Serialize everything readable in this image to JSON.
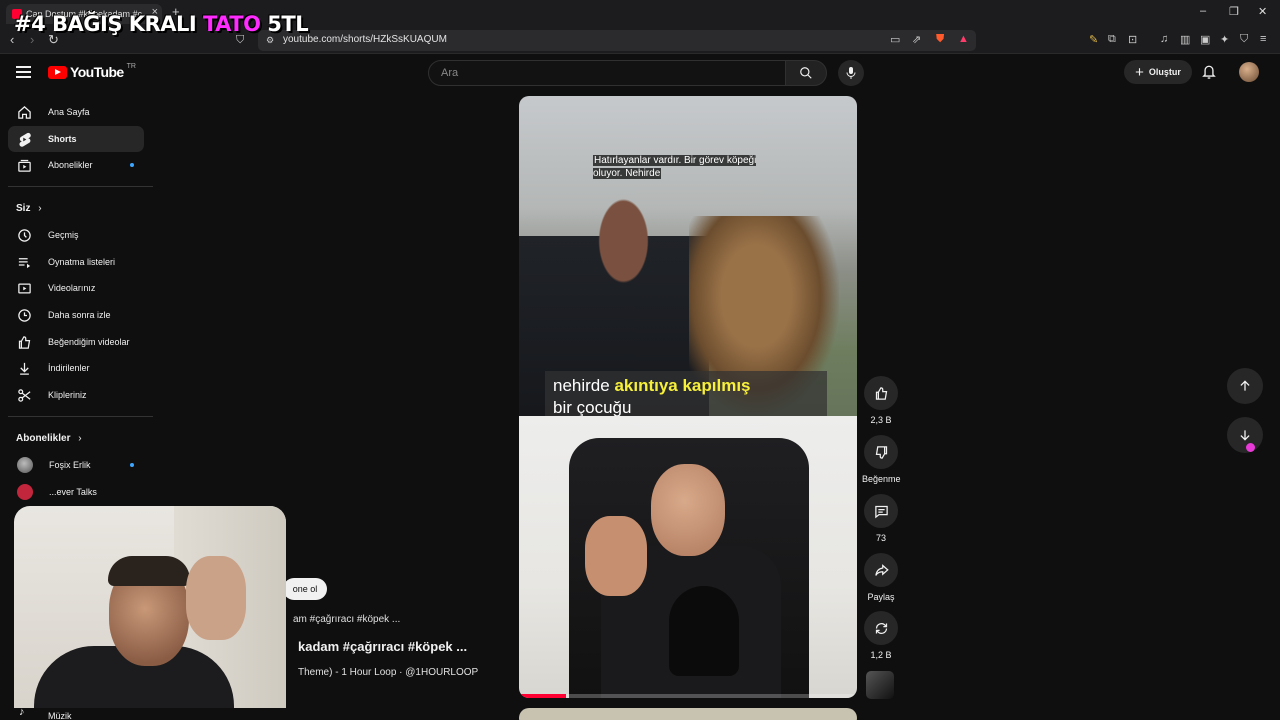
{
  "browser": {
    "tab_title": "Can Dostum #köpekadam #ç",
    "url": "youtube.com/shorts/HZkSsKUAQUM"
  },
  "overlay": {
    "part1": "#4 BAĞIŞ KRALI",
    "part2": "TATO",
    "part3": "5TL"
  },
  "header": {
    "logo_text": "YouTube",
    "logo_region": "TR",
    "search_placeholder": "Ara",
    "create_label": "Oluştur"
  },
  "sidebar": {
    "items": [
      {
        "label": "Ana Sayfa",
        "icon": "home-icon"
      },
      {
        "label": "Shorts",
        "icon": "shorts-icon",
        "active": true
      },
      {
        "label": "Abonelikler",
        "icon": "subscriptions-icon"
      }
    ],
    "you_heading": "Siz",
    "you_items": [
      {
        "label": "Geçmiş",
        "icon": "history-icon"
      },
      {
        "label": "Oynatma listeleri",
        "icon": "playlist-icon"
      },
      {
        "label": "Videolarınız",
        "icon": "video-icon"
      },
      {
        "label": "Daha sonra izle",
        "icon": "clock-icon"
      },
      {
        "label": "Beğendiğim videolar",
        "icon": "like-icon"
      },
      {
        "label": "İndirilenler",
        "icon": "download-icon"
      },
      {
        "label": "Klipleriniz",
        "icon": "scissors-icon"
      }
    ],
    "subs_heading": "Abonelikler",
    "channels": [
      {
        "name": "Foşix Erlik"
      },
      {
        "name": "...ever Talks"
      }
    ],
    "bottom_item": "Müzik"
  },
  "short": {
    "caption_top": "Hatırlayanlar vardır. Bir görev köpeği oluyor. Nehirde",
    "caption_bottom_1": "nehirde ",
    "caption_bottom_hl": "akıntıya kapılmış",
    "caption_bottom_2": "bir çocuğu",
    "progress_fraction": 0.14
  },
  "actions": {
    "like_count": "2,3 B",
    "dislike_label": "Beğenme",
    "comment_count": "73",
    "share_label": "Paylaş",
    "remix_count": "1,2 B"
  },
  "meta": {
    "subscribe_label": "one ol",
    "hashtags": "am #çağrıracı #köpek ...",
    "title": "kadam #çağrıracı #köpek ...",
    "audio": "Theme) - 1 Hour Loop · @1HOURLOOP"
  },
  "colors": {
    "accent": "#ff0033",
    "overlay_pink": "#ff2bff",
    "caption_highlight": "#f7f03a"
  }
}
